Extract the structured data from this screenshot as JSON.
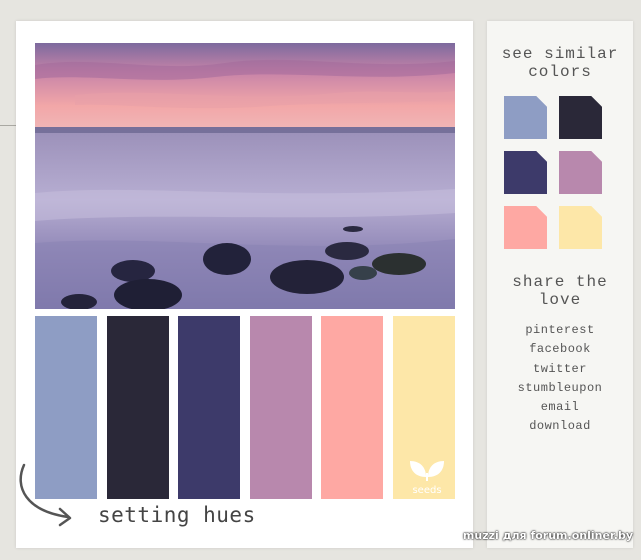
{
  "palette": {
    "colors": [
      "#8e9dc4",
      "#2a2838",
      "#3d3a6a",
      "#b888ad",
      "#fea8a3",
      "#fde7a8"
    ]
  },
  "caption": "setting hues",
  "logo_text": "seeds",
  "sidebar": {
    "similar_title": "see similar colors",
    "similar_colors": [
      "#8e9dc4",
      "#2a2838",
      "#3d3a6a",
      "#b888ad",
      "#fea8a3",
      "#fde7a8"
    ],
    "share_title": "share the love",
    "share_links": [
      "pinterest",
      "facebook",
      "twitter",
      "stumbleupon",
      "email",
      "download"
    ]
  },
  "credit": "muzzi для forum.onliner.by",
  "icons": {
    "logo": "seeds-leaf-icon",
    "arrow": "curved-arrow-icon"
  }
}
